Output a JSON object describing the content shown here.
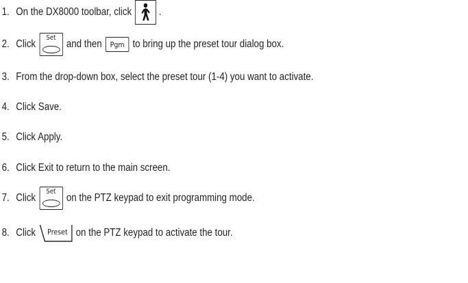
{
  "steps": [
    {
      "num": "1.",
      "before": "On the DX8000 toolbar, click",
      "after": "."
    },
    {
      "num": "2.",
      "before": "Click",
      "middle": "and then",
      "after": "to bring up the preset tour dialog box."
    },
    {
      "num": "3.",
      "text": "From the drop-down box, select the preset tour (1-4) you want to activate."
    },
    {
      "num": "4.",
      "text": "Click Save."
    },
    {
      "num": "5.",
      "text": "Click Apply."
    },
    {
      "num": "6.",
      "text": "Click Exit to return to the main screen."
    },
    {
      "num": "7.",
      "before": "Click",
      "after": "on the PTZ keypad to exit programming mode."
    },
    {
      "num": "8.",
      "before": "Click",
      "after": "on the PTZ keypad to activate the tour."
    }
  ],
  "buttons": {
    "set_label": "Set",
    "pgm_label": "Pgm",
    "preset_label": "Preset"
  },
  "icons": {
    "toolbar": "walking-person-icon"
  }
}
